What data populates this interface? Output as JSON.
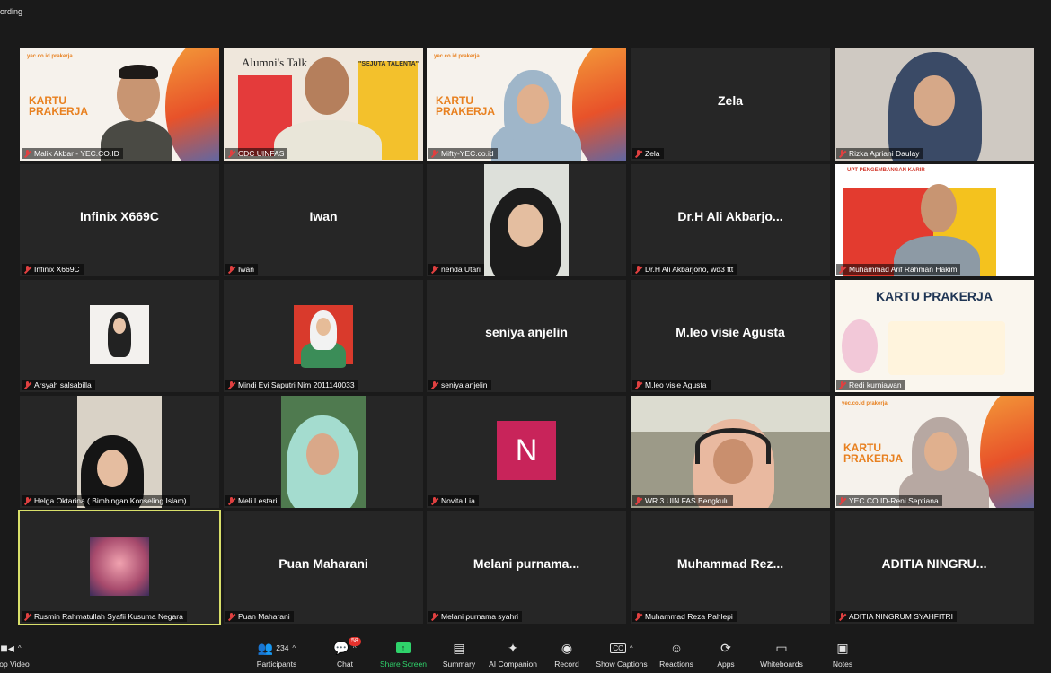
{
  "top": {
    "recording_text": "ording"
  },
  "tiles": [
    {
      "name": "Malik Akbar - YEC.CO.ID",
      "big": "",
      "kind": "slide-man"
    },
    {
      "name": "CDC UINFAS",
      "big": "",
      "kind": "alumni"
    },
    {
      "name": "Mifty-YEC.co.id",
      "big": "",
      "kind": "slide-woman"
    },
    {
      "name": "Zela",
      "big": "Zela",
      "kind": "blank"
    },
    {
      "name": "Rizka Apriani Daulay",
      "big": "",
      "kind": "hijab-cam"
    },
    {
      "name": "Infinix X669C",
      "big": "Infinix X669C",
      "kind": "blank"
    },
    {
      "name": "Iwan",
      "big": "Iwan",
      "kind": "blank"
    },
    {
      "name": "nenda Utari",
      "big": "",
      "kind": "nenda"
    },
    {
      "name": "Dr.H Ali Akbarjono, wd3 ftt",
      "big": "Dr.H  Ali  Akbarjo...",
      "kind": "blank"
    },
    {
      "name": "Muhammad Arif Rahman Hakim",
      "big": "",
      "kind": "upt"
    },
    {
      "name": "Arsyah salsabilla",
      "big": "",
      "kind": "thumb-white"
    },
    {
      "name": "Mindi Evi Saputri Nim 2011140033",
      "big": "",
      "kind": "thumb-red"
    },
    {
      "name": "seniya anjelin",
      "big": "seniya anjelin",
      "kind": "blank"
    },
    {
      "name": "M.leo visie Agusta",
      "big": "M.leo visie Agusta",
      "kind": "blank"
    },
    {
      "name": "Redi kurniawan",
      "big": "",
      "kind": "poster"
    },
    {
      "name": "Helga Oktarina ( Bimbingan Konseling Islam)",
      "big": "",
      "kind": "helga"
    },
    {
      "name": "Meli Lestari",
      "big": "",
      "kind": "meli"
    },
    {
      "name": "Novita Lia",
      "big": "",
      "kind": "avatar-n",
      "initial": "N"
    },
    {
      "name": "WR 3 UIN FAS Bengkulu",
      "big": "",
      "kind": "wr3"
    },
    {
      "name": "YEC.CO.ID-Reni Septiana",
      "big": "",
      "kind": "slide-woman2"
    },
    {
      "name": "Rusmin Rahmatullah Syafii Kusuma Negara",
      "big": "",
      "kind": "brain",
      "active": true
    },
    {
      "name": "Puan Maharani",
      "big": "Puan Maharani",
      "kind": "blank"
    },
    {
      "name": "Melani purnama syahri",
      "big": "Melani  purnama...",
      "kind": "blank"
    },
    {
      "name": "Muhammad Reza Pahlepi",
      "big": "Muhammad  Rez...",
      "kind": "blank"
    },
    {
      "name": "ADITIA NINGRUM SYAHFITRI",
      "big": "ADITIA  NINGRU...",
      "kind": "blank"
    }
  ],
  "slides": {
    "prakerja_title": "KARTU PRAKERJA",
    "yec_logo": "yec.co.id  prakerja",
    "alumni_title": "Alumni's Talk",
    "alumni_badge": "\"SEJUTA TALENTA\"",
    "upt_title": "UPT PENGEMBANGAN KARIR",
    "poster_title": "KARTU PRAKERJA"
  },
  "toolbar": {
    "stop_video": "Stop Video",
    "participants": "Participants",
    "participants_count": "234",
    "chat": "Chat",
    "chat_badge": "58",
    "share_screen": "Share Screen",
    "summary": "Summary",
    "ai_companion": "AI Companion",
    "record": "Record",
    "show_captions": "Show Captions",
    "reactions": "Reactions",
    "apps": "Apps",
    "whiteboards": "Whiteboards",
    "notes": "Notes"
  }
}
